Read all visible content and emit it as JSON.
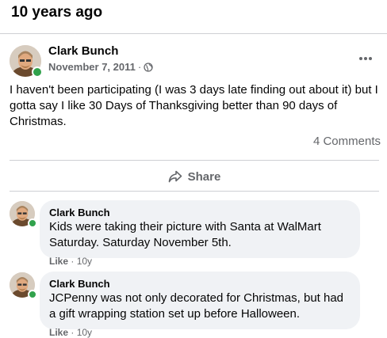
{
  "memory": {
    "heading": "10 years ago"
  },
  "post": {
    "author": "Clark Bunch",
    "date": "November 7, 2011",
    "separator": "·",
    "audience_icon": "globe-icon",
    "more_icon": "more-horizontal-icon",
    "text": "I haven't been participating (I was 3 days late finding out about it) but I gotta say I like 30 Days of Thanksgiving better than 90 days of Christmas.",
    "comment_count": "4 Comments",
    "share_label": "Share",
    "share_icon": "share-arrow-icon",
    "online_status_color": "#31a24c"
  },
  "comments": [
    {
      "author": "Clark Bunch",
      "text": "Kids were taking their picture with Santa at WalMart Saturday. Saturday November 5th.",
      "like_label": "Like",
      "separator": "·",
      "age": "10y"
    },
    {
      "author": "Clark Bunch",
      "text": "JCPenny was not only decorated for Christmas, but had a gift wrapping station set up before Halloween.",
      "like_label": "Like",
      "separator": "·",
      "age": "10y"
    }
  ]
}
